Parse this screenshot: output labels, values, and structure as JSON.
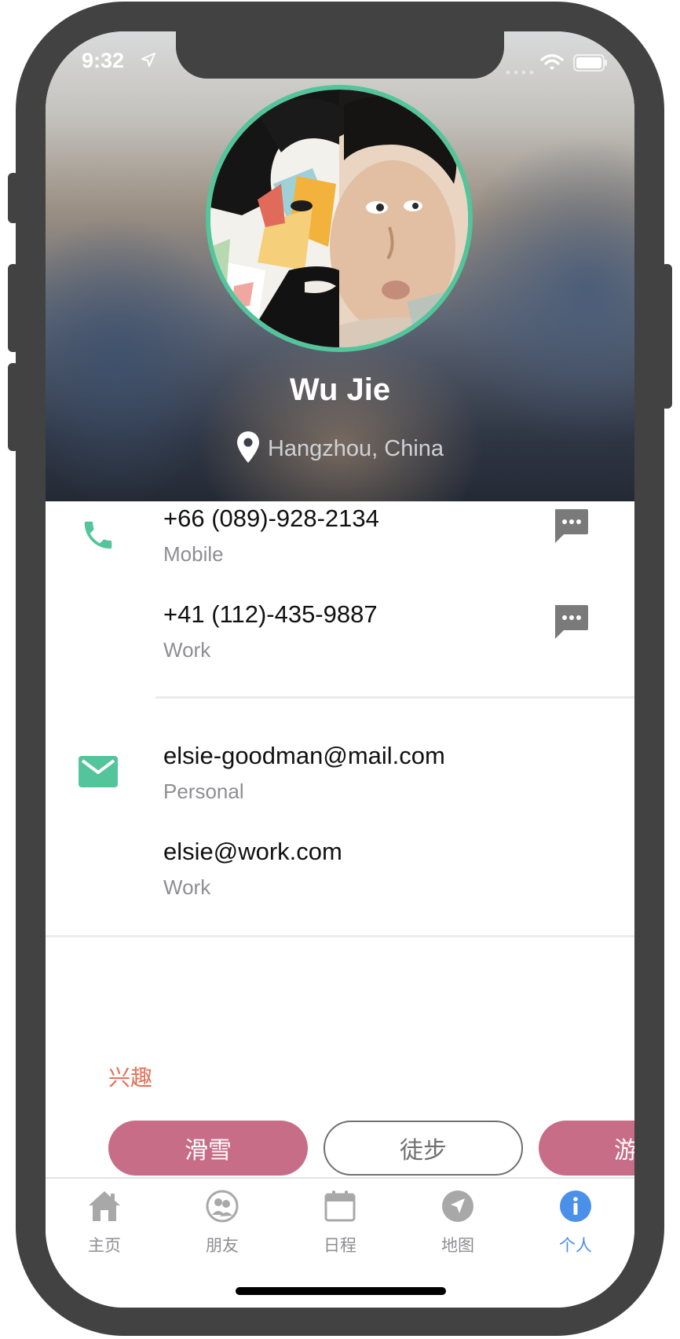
{
  "status_bar": {
    "time": "9:32",
    "icons": [
      "location-arrow-icon",
      "cellular-signal-icon",
      "wifi-icon",
      "battery-icon"
    ]
  },
  "profile": {
    "name": "Wu Jie",
    "location": "Hangzhou, China",
    "location_icon": "map-pin-icon",
    "avatar_ring_color": "#54c49b"
  },
  "phones": {
    "icon": "phone-icon",
    "items": [
      {
        "number": "+66 (089)-928-2134",
        "label": "Mobile",
        "action_icon": "message-bubble-icon"
      },
      {
        "number": "+41 (112)-435-9887",
        "label": "Work",
        "action_icon": "message-bubble-icon"
      }
    ]
  },
  "emails": {
    "icon": "mail-icon",
    "items": [
      {
        "address": "elsie-goodman@mail.com",
        "label": "Personal"
      },
      {
        "address": "elsie@work.com",
        "label": "Work"
      }
    ]
  },
  "interests": {
    "title": "兴趣",
    "tags": [
      {
        "label": "滑雪",
        "style": "filled"
      },
      {
        "label": "徒步",
        "style": "outline"
      },
      {
        "label": "游",
        "style": "filled"
      }
    ]
  },
  "tabbar": {
    "items": [
      {
        "label": "主页",
        "icon": "home-icon",
        "active": false
      },
      {
        "label": "朋友",
        "icon": "friends-icon",
        "active": false
      },
      {
        "label": "日程",
        "icon": "calendar-icon",
        "active": false
      },
      {
        "label": "地图",
        "icon": "navigation-icon",
        "active": false
      },
      {
        "label": "个人",
        "icon": "info-icon",
        "active": true
      }
    ]
  },
  "colors": {
    "accent_green": "#54c49b",
    "interest_pink": "#c76d87",
    "interest_title": "#e0735b",
    "tab_active": "#4a8fe8",
    "tab_inactive": "#8e8e93"
  }
}
